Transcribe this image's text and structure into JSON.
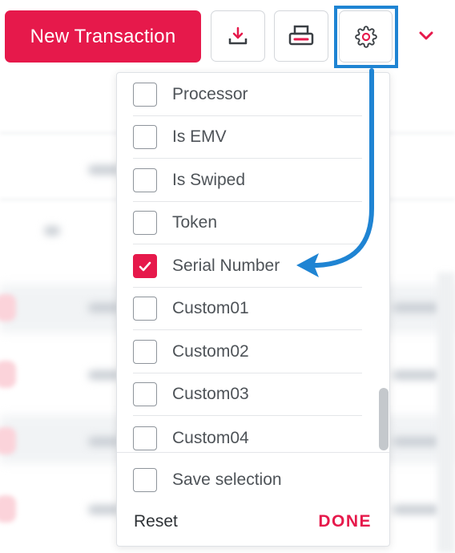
{
  "toolbar": {
    "new_transaction_label": "New Transaction",
    "download_icon": "download-icon",
    "print_icon": "printer-icon",
    "settings_icon": "gear-icon",
    "more_icon": "chevron-down-icon"
  },
  "columns_menu": {
    "items": [
      {
        "label": "Processor",
        "checked": false
      },
      {
        "label": "Is EMV",
        "checked": false
      },
      {
        "label": "Is Swiped",
        "checked": false
      },
      {
        "label": "Token",
        "checked": false
      },
      {
        "label": "Serial Number",
        "checked": true
      },
      {
        "label": "Custom01",
        "checked": false
      },
      {
        "label": "Custom02",
        "checked": false
      },
      {
        "label": "Custom03",
        "checked": false
      },
      {
        "label": "Custom04",
        "checked": false
      }
    ],
    "save_selection_label": "Save selection",
    "save_selection_checked": false,
    "reset_label": "Reset",
    "done_label": "DONE"
  },
  "colors": {
    "accent": "#e6194b",
    "highlight": "#1f84d3"
  }
}
